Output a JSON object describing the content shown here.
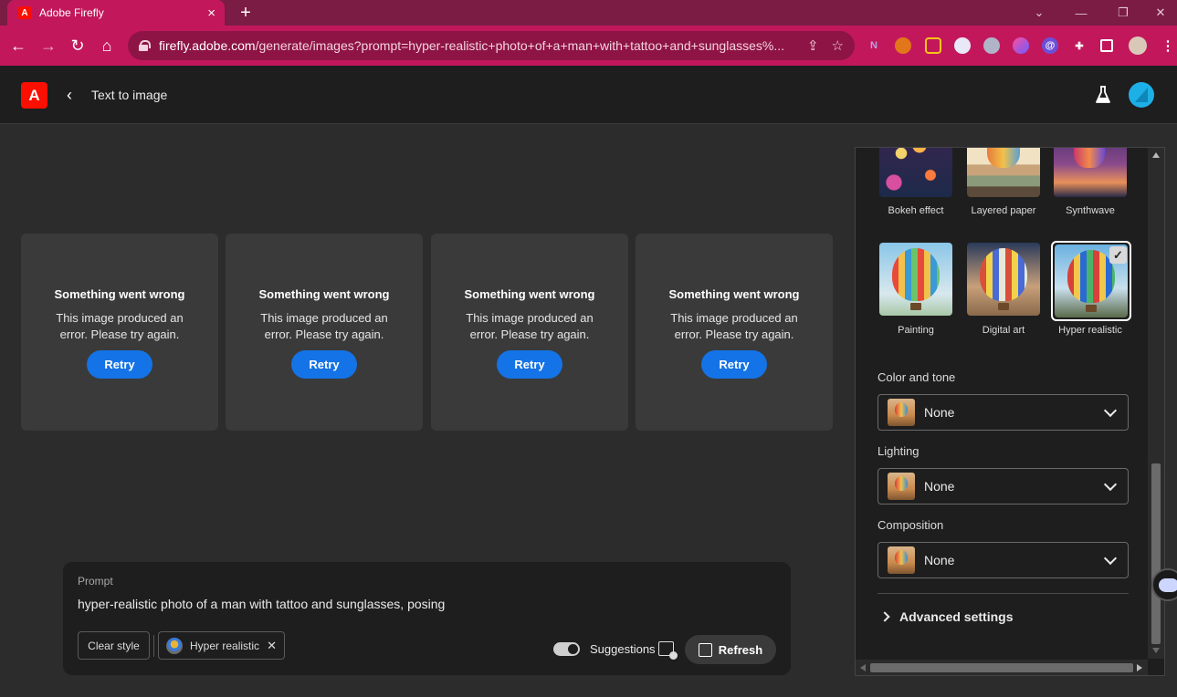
{
  "browser": {
    "tab_title": "Adobe Firefly",
    "tab_favicon": "A",
    "new_tab": "+",
    "url_host": "firefly.adobe.com",
    "url_path": "/generate/images?prompt=hyper-realistic+photo+of+a+man+with+tattoo+and+sunglasses%...",
    "window_controls": [
      "⌄",
      "—",
      "❐",
      "✕"
    ],
    "nav": {
      "back": "←",
      "forward": "→",
      "reload": "↻",
      "home": "⌂"
    },
    "omnibox_icons": {
      "share": "⇪",
      "bookmark": "☆"
    },
    "extension_icons": [
      "notion-icon",
      "metamask-icon",
      "grammar-icon",
      "discord-icon",
      "owl-icon",
      "color-icon",
      "at-icon",
      "puzzle-icon",
      "sidebar-icon",
      "profile-avatar-icon",
      "more-menu-icon"
    ]
  },
  "header": {
    "logo": "A",
    "back": "‹",
    "title": "Text to image"
  },
  "results": {
    "cards": [
      {
        "title": "Something went wrong",
        "message": "This image produced an error. Please try again.",
        "action": "Retry"
      },
      {
        "title": "Something went wrong",
        "message": "This image produced an error. Please try again.",
        "action": "Retry"
      },
      {
        "title": "Something went wrong",
        "message": "This image produced an error. Please try again.",
        "action": "Retry"
      },
      {
        "title": "Something went wrong",
        "message": "This image produced an error. Please try again.",
        "action": "Retry"
      }
    ]
  },
  "prompt": {
    "label": "Prompt",
    "text": "hyper-realistic photo of a man with tattoo and sunglasses, posing",
    "clear_style": "Clear style",
    "style_chip": "Hyper realistic",
    "chip_remove": "✕",
    "suggestions_label": "Suggestions",
    "suggestions_enabled": true,
    "refresh": "Refresh"
  },
  "panel": {
    "styles": [
      {
        "label": "Bokeh effect",
        "selected": false
      },
      {
        "label": "Layered paper",
        "selected": false
      },
      {
        "label": "Synthwave",
        "selected": false
      },
      {
        "label": "Painting",
        "selected": false
      },
      {
        "label": "Digital art",
        "selected": false
      },
      {
        "label": "Hyper realistic",
        "selected": true
      }
    ],
    "check": "✓",
    "color_and_tone": {
      "label": "Color and tone",
      "value": "None"
    },
    "lighting": {
      "label": "Lighting",
      "value": "None"
    },
    "composition": {
      "label": "Composition",
      "value": "None"
    },
    "advanced": "Advanced settings"
  },
  "colors": {
    "accent": "#1473e6",
    "brand": "#fa0f00",
    "browser_frame": "#c2185b",
    "tab_strip": "#7a1c43"
  }
}
